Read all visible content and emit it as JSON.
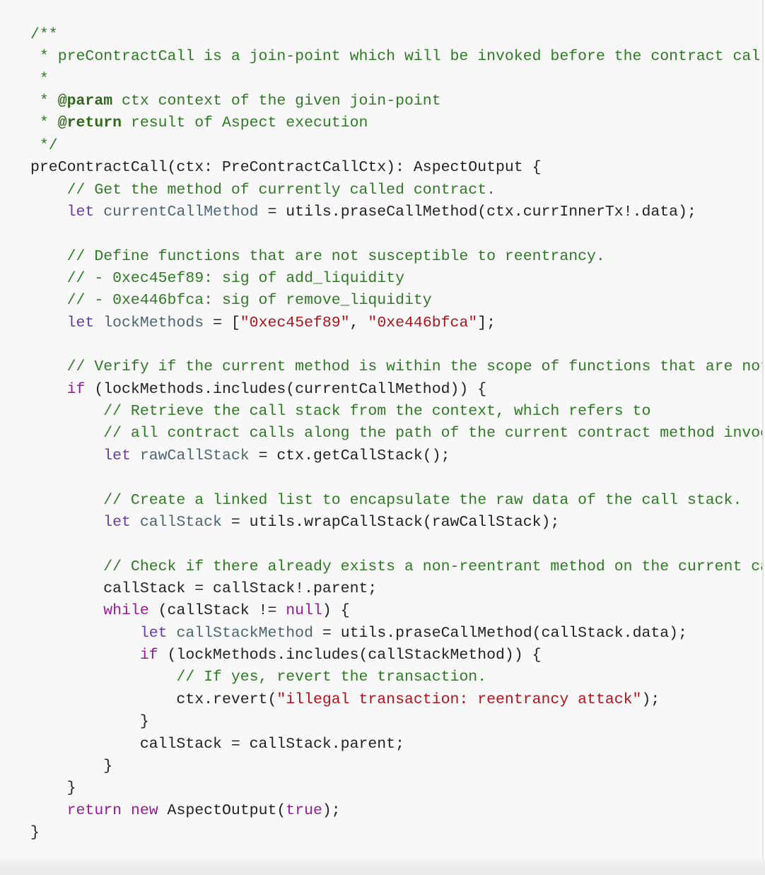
{
  "colors": {
    "background": "#f8f8f8",
    "comment": "#2f7a24",
    "keyword": "#6a3aa8",
    "keyword_alt": "#981a98",
    "definition": "#4d6670",
    "string": "#b3121a"
  },
  "code_lines": [
    [
      [
        "comment",
        "/**"
      ]
    ],
    [
      [
        "comment",
        " * preContractCall is a join-point which will be invoked before the contract call"
      ]
    ],
    [
      [
        "comment",
        " *"
      ]
    ],
    [
      [
        "comment",
        " * "
      ],
      [
        "doctag",
        "@param"
      ],
      [
        "comment",
        " ctx context of the given join-point"
      ]
    ],
    [
      [
        "comment",
        " * "
      ],
      [
        "doctag",
        "@return"
      ],
      [
        "comment",
        " result of Aspect execution"
      ]
    ],
    [
      [
        "comment",
        " */"
      ]
    ],
    [
      [
        "plain",
        "preContractCall(ctx: PreContractCallCtx): AspectOutput {"
      ]
    ],
    [
      [
        "plain",
        "    "
      ],
      [
        "comment",
        "// Get the method of currently called contract."
      ]
    ],
    [
      [
        "plain",
        "    "
      ],
      [
        "keyword",
        "let"
      ],
      [
        "plain",
        " "
      ],
      [
        "def",
        "currentCallMethod"
      ],
      [
        "plain",
        " = utils.praseCallMethod(ctx.currInnerTx!.data);"
      ]
    ],
    [],
    [
      [
        "plain",
        "    "
      ],
      [
        "comment",
        "// Define functions that are not susceptible to reentrancy."
      ]
    ],
    [
      [
        "plain",
        "    "
      ],
      [
        "comment",
        "// - 0xec45ef89: sig of add_liquidity"
      ]
    ],
    [
      [
        "plain",
        "    "
      ],
      [
        "comment",
        "// - 0xe446bfca: sig of remove_liquidity"
      ]
    ],
    [
      [
        "plain",
        "    "
      ],
      [
        "keyword",
        "let"
      ],
      [
        "plain",
        " "
      ],
      [
        "def",
        "lockMethods"
      ],
      [
        "plain",
        " = ["
      ],
      [
        "string",
        "\"0xec45ef89\""
      ],
      [
        "plain",
        ", "
      ],
      [
        "string",
        "\"0xe446bfca\""
      ],
      [
        "plain",
        "];"
      ]
    ],
    [],
    [
      [
        "plain",
        "    "
      ],
      [
        "comment",
        "// Verify if the current method is within the scope of functions that are not susceptible to reentrancy."
      ]
    ],
    [
      [
        "plain",
        "    "
      ],
      [
        "kw2",
        "if"
      ],
      [
        "plain",
        " (lockMethods.includes(currentCallMethod)) {"
      ]
    ],
    [
      [
        "plain",
        "        "
      ],
      [
        "comment",
        "// Retrieve the call stack from the context, which refers to"
      ]
    ],
    [
      [
        "plain",
        "        "
      ],
      [
        "comment",
        "// all contract calls along the path of the current contract method invocation."
      ]
    ],
    [
      [
        "plain",
        "        "
      ],
      [
        "keyword",
        "let"
      ],
      [
        "plain",
        " "
      ],
      [
        "def",
        "rawCallStack"
      ],
      [
        "plain",
        " = ctx.getCallStack();"
      ]
    ],
    [],
    [
      [
        "plain",
        "        "
      ],
      [
        "comment",
        "// Create a linked list to encapsulate the raw data of the call stack."
      ]
    ],
    [
      [
        "plain",
        "        "
      ],
      [
        "keyword",
        "let"
      ],
      [
        "plain",
        " "
      ],
      [
        "def",
        "callStack"
      ],
      [
        "plain",
        " = utils.wrapCallStack(rawCallStack);"
      ]
    ],
    [],
    [
      [
        "plain",
        "        "
      ],
      [
        "comment",
        "// Check if there already exists a non-reentrant method on the current call path."
      ]
    ],
    [
      [
        "plain",
        "        callStack = callStack!.parent;"
      ]
    ],
    [
      [
        "plain",
        "        "
      ],
      [
        "kw2",
        "while"
      ],
      [
        "plain",
        " (callStack != "
      ],
      [
        "kw2",
        "null"
      ],
      [
        "plain",
        ") {"
      ]
    ],
    [
      [
        "plain",
        "            "
      ],
      [
        "keyword",
        "let"
      ],
      [
        "plain",
        " "
      ],
      [
        "def",
        "callStackMethod"
      ],
      [
        "plain",
        " = utils.praseCallMethod(callStack.data);"
      ]
    ],
    [
      [
        "plain",
        "            "
      ],
      [
        "kw2",
        "if"
      ],
      [
        "plain",
        " (lockMethods.includes(callStackMethod)) {"
      ]
    ],
    [
      [
        "plain",
        "                "
      ],
      [
        "comment",
        "// If yes, revert the transaction."
      ]
    ],
    [
      [
        "plain",
        "                ctx.revert("
      ],
      [
        "string",
        "\"illegal transaction: reentrancy attack\""
      ],
      [
        "plain",
        ");"
      ]
    ],
    [
      [
        "plain",
        "            }"
      ]
    ],
    [
      [
        "plain",
        "            callStack = callStack.parent;"
      ]
    ],
    [
      [
        "plain",
        "        }"
      ]
    ],
    [
      [
        "plain",
        "    }"
      ]
    ],
    [
      [
        "plain",
        "    "
      ],
      [
        "kw2",
        "return"
      ],
      [
        "plain",
        " "
      ],
      [
        "kw2",
        "new"
      ],
      [
        "plain",
        " AspectOutput("
      ],
      [
        "kw2",
        "true"
      ],
      [
        "plain",
        ");"
      ]
    ],
    [
      [
        "plain",
        "}"
      ]
    ]
  ]
}
